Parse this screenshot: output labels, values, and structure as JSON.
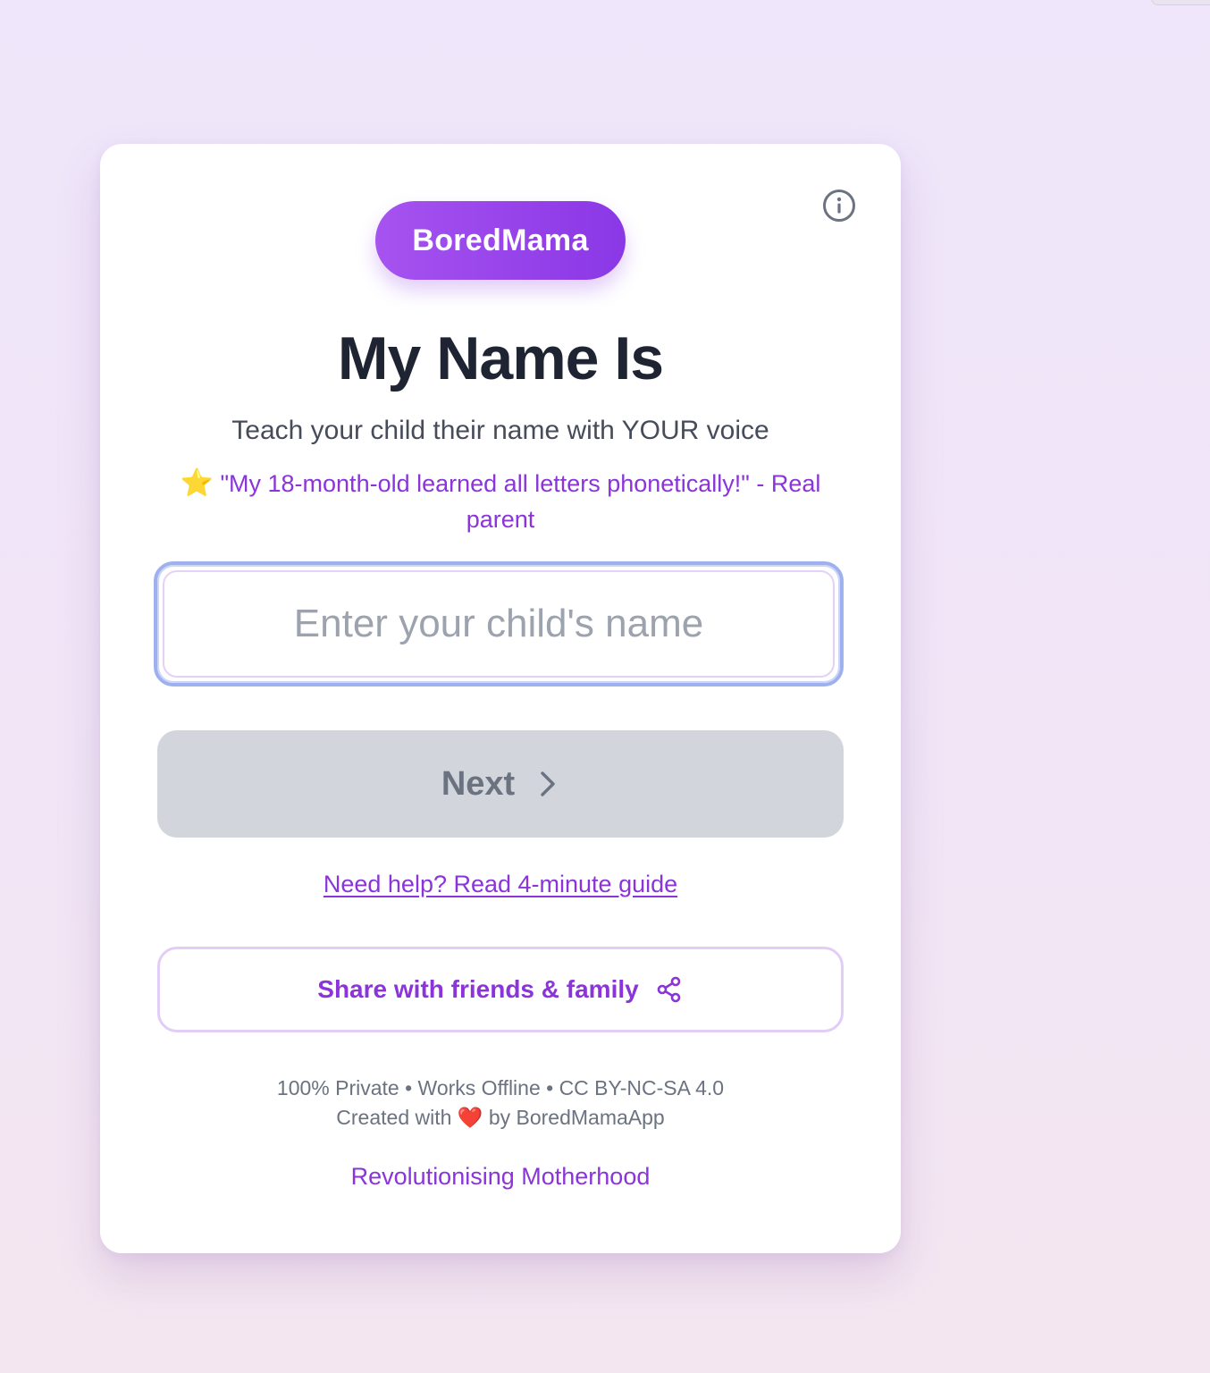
{
  "brand": {
    "label": "BoredMama",
    "accent_start": "#a653f0",
    "accent_end": "#8a37e6"
  },
  "header": {
    "info_icon": "info-circle-icon"
  },
  "main": {
    "title": "My Name Is",
    "subtitle": "Teach your child their name with YOUR voice",
    "testimonial": {
      "icon": "⭐",
      "text": "\"My 18-month-old learned all letters phonetically!\" - Real parent"
    },
    "name_input": {
      "value": "",
      "placeholder": "Enter your child's name"
    },
    "next_button": {
      "label": "Next",
      "icon": "chevron-right-icon",
      "disabled": true
    },
    "help_link": "Need help? Read 4-minute guide",
    "share_button": {
      "label": "Share with friends & family",
      "icon": "share-icon"
    }
  },
  "footer": {
    "line1": "100% Private • Works Offline • CC BY-NC-SA 4.0",
    "line2_prefix": "Created with",
    "heart": "❤️",
    "line2_suffix": "by BoredMamaApp",
    "tagline": "Revolutionising Motherhood"
  },
  "colors": {
    "accent": "#8a34d9",
    "title": "#1f2433",
    "muted": "#6b7280",
    "disabled_bg": "#d2d5db",
    "input_focus_ring": "#9fb0ee"
  }
}
